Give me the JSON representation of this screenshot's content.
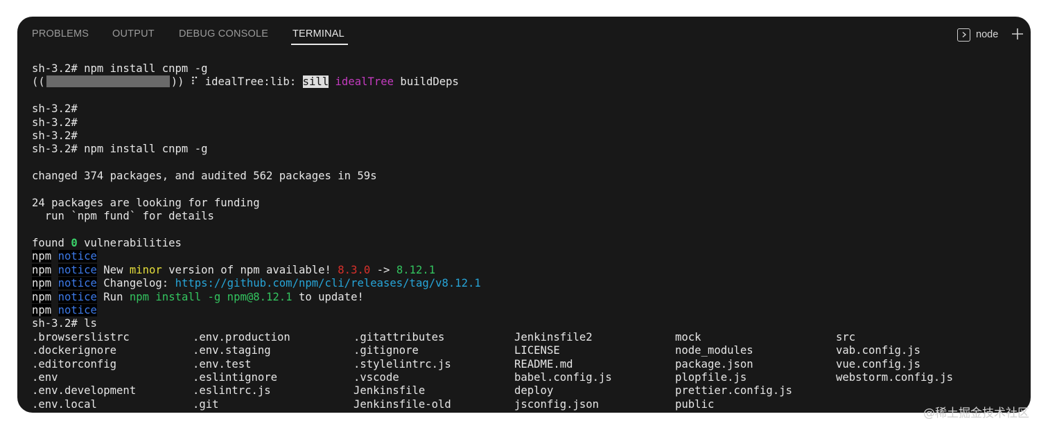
{
  "tabs": [
    {
      "label": "PROBLEMS"
    },
    {
      "label": "OUTPUT"
    },
    {
      "label": "DEBUG CONSOLE"
    },
    {
      "label": "TERMINAL"
    }
  ],
  "shell": {
    "label": "node",
    "icon": "terminal-icon"
  },
  "actions": {
    "new_terminal_icon": "plus-icon"
  },
  "terminal": {
    "cmd1": "sh-3.2# npm install cnpm -g",
    "progress": {
      "open": "((",
      "close": "))",
      "spin": " ⠏ ",
      "stage": "idealTree:lib: ",
      "level": "sill",
      "tag": "idealTree",
      "msg": " buildDeps"
    },
    "prompt": "sh-3.2#",
    "cmd2": "sh-3.2# npm install cnpm -g",
    "changed": "changed 374 packages, and audited 562 packages in 59s",
    "funding1": "24 packages are looking for funding",
    "funding2": "  run `npm fund` for details",
    "found_pre": "found ",
    "found_num": "0",
    "found_post": " vulnerabilities",
    "npm": "npm",
    "notice": "notice",
    "n2_a": " New ",
    "n2_minor": "minor",
    "n2_b": " version of npm available! ",
    "n2_old": "8.3.0",
    "n2_arrow": " -> ",
    "n2_new": "8.12.1",
    "n3_a": " Changelog: ",
    "n3_link": "https://github.com/npm/cli/releases/tag/v8.12.1",
    "n4_a": " Run ",
    "n4_cmd": "npm install -g npm@8.12.1",
    "n4_b": " to update!",
    "cmd3": "sh-3.2# ls",
    "ls_columns": [
      [
        ".browserslistrc",
        ".dockerignore",
        ".editorconfig",
        ".env",
        ".env.development",
        ".env.local"
      ],
      [
        ".env.production",
        ".env.staging",
        ".env.test",
        ".eslintignore",
        ".eslintrc.js",
        ".git"
      ],
      [
        ".gitattributes",
        ".gitignore",
        ".stylelintrc.js",
        ".vscode",
        "Jenkinsfile",
        "Jenkinsfile-old"
      ],
      [
        "Jenkinsfile2",
        "LICENSE",
        "README.md",
        "babel.config.js",
        "deploy",
        "jsconfig.json"
      ],
      [
        "mock",
        "node_modules",
        "package.json",
        "plopfile.js",
        "prettier.config.js",
        "public"
      ],
      [
        "src",
        "vab.config.js",
        "vue.config.js",
        "webstorm.config.js"
      ]
    ]
  },
  "watermark": "@稀土掘金技术社区"
}
